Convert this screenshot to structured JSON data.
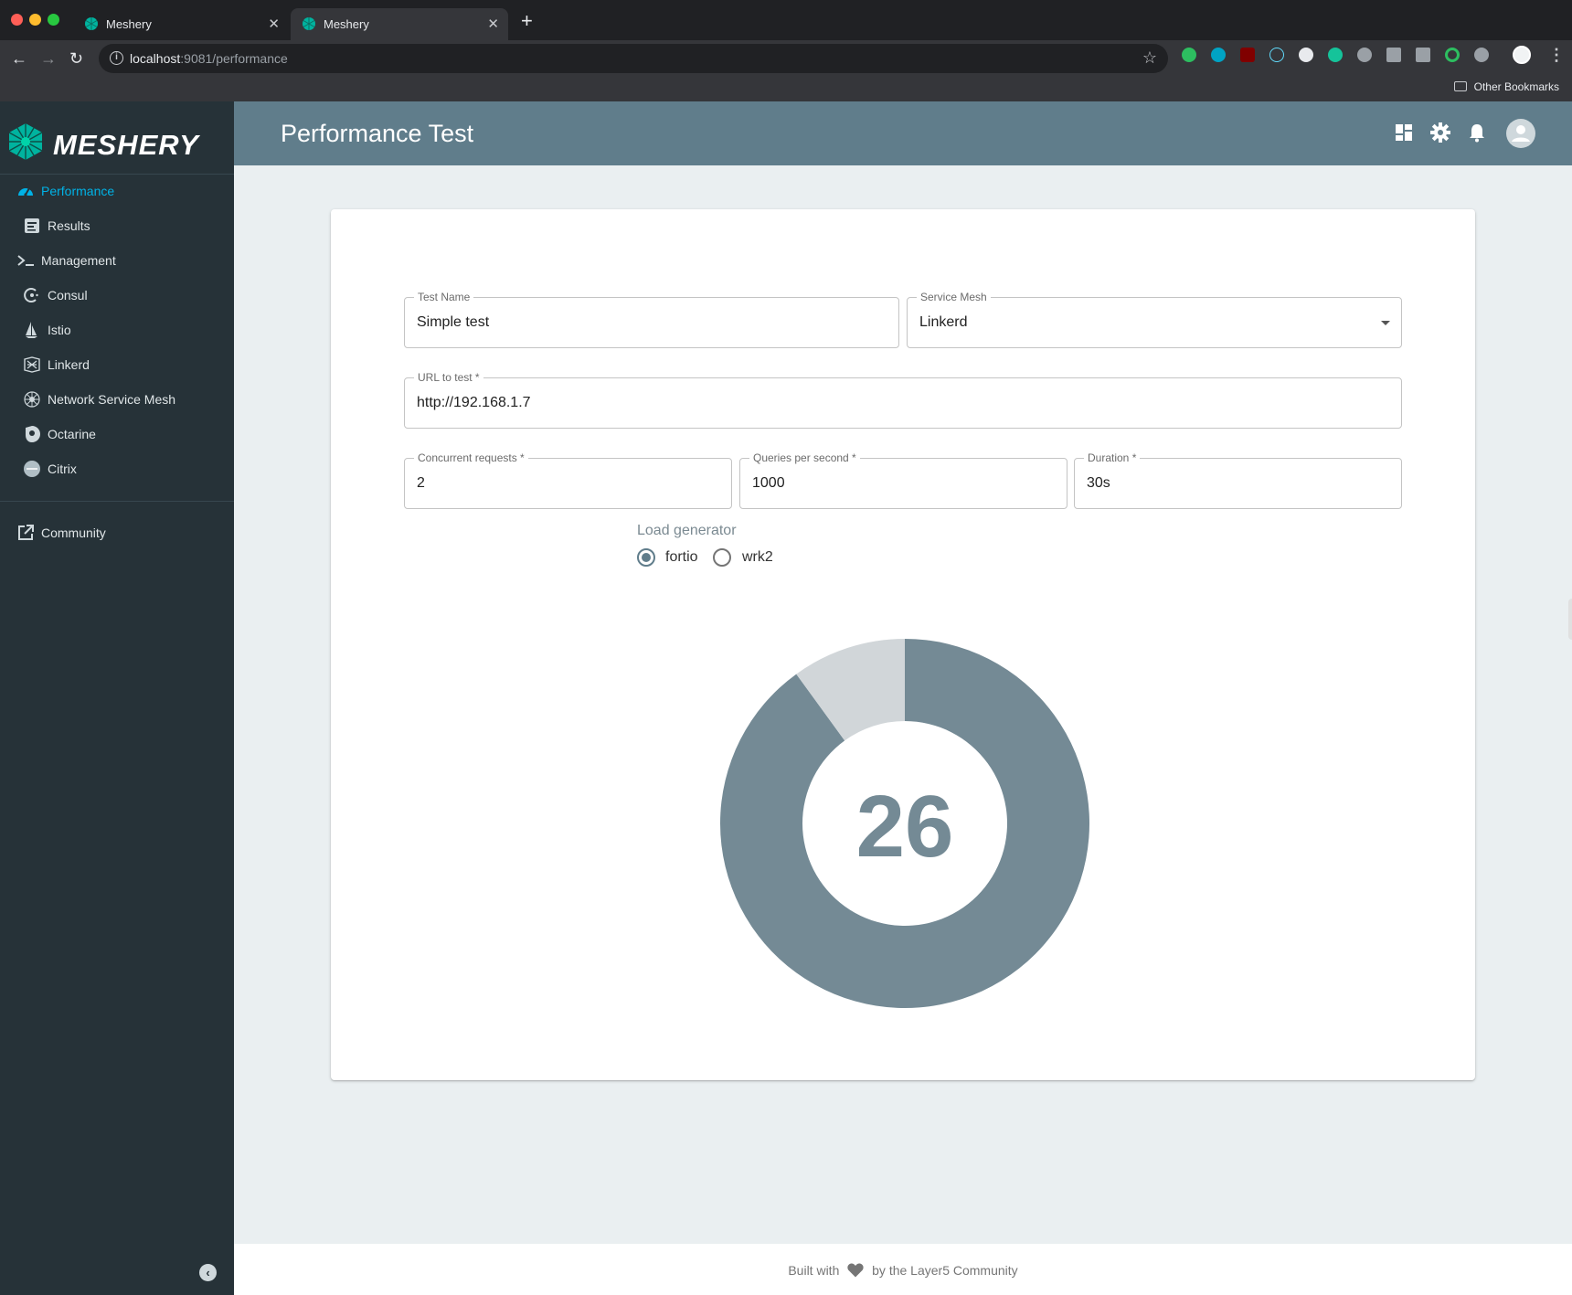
{
  "browser": {
    "tabs": [
      {
        "title": "Meshery",
        "active": false
      },
      {
        "title": "Meshery",
        "active": true
      }
    ],
    "address": {
      "host": "localhost",
      "rest": ":9081/performance"
    },
    "bookmarks": {
      "other": "Other Bookmarks"
    }
  },
  "sidebar": {
    "brand": "MESHERY",
    "items": [
      {
        "label": "Performance",
        "icon": "speedometer-icon",
        "active": true
      },
      {
        "label": "Results",
        "icon": "results-icon"
      },
      {
        "label": "Management",
        "icon": "terminal-icon"
      },
      {
        "label": "Consul",
        "icon": "consul-icon"
      },
      {
        "label": "Istio",
        "icon": "istio-icon"
      },
      {
        "label": "Linkerd",
        "icon": "linkerd-icon"
      },
      {
        "label": "Network Service Mesh",
        "icon": "nsm-icon"
      },
      {
        "label": "Octarine",
        "icon": "octarine-icon"
      },
      {
        "label": "Citrix",
        "icon": "citrix-icon"
      }
    ],
    "community": {
      "label": "Community",
      "icon": "external-link-icon"
    }
  },
  "appbar": {
    "title": "Performance Test",
    "icons": [
      "dashboard-icon",
      "gear-icon",
      "bell-icon",
      "account-icon"
    ]
  },
  "form": {
    "test_name": {
      "label": "Test Name",
      "value": "Simple test"
    },
    "service_mesh": {
      "label": "Service Mesh",
      "value": "Linkerd"
    },
    "url": {
      "label": "URL to test *",
      "value": "http://192.168.1.7"
    },
    "concurrent": {
      "label": "Concurrent requests *",
      "value": "2"
    },
    "qps": {
      "label": "Queries per second *",
      "value": "1000"
    },
    "duration": {
      "label": "Duration *",
      "value": "30s"
    },
    "load_generator": {
      "label": "Load generator",
      "options": [
        "fortio",
        "wrk2"
      ],
      "selected": "fortio"
    }
  },
  "timer": {
    "remaining": "26",
    "progress_fraction": 0.1,
    "colors": {
      "progress": "#d1d6d9",
      "remaining": "#748a95",
      "text": "#748a95"
    }
  },
  "footer": {
    "prefix": "Built with",
    "suffix": "by the Layer5 Community"
  },
  "colors": {
    "sidebar": "#263238",
    "appbar": "#607d8b",
    "accent": "#00b2e6",
    "background": "#eaeff1"
  }
}
